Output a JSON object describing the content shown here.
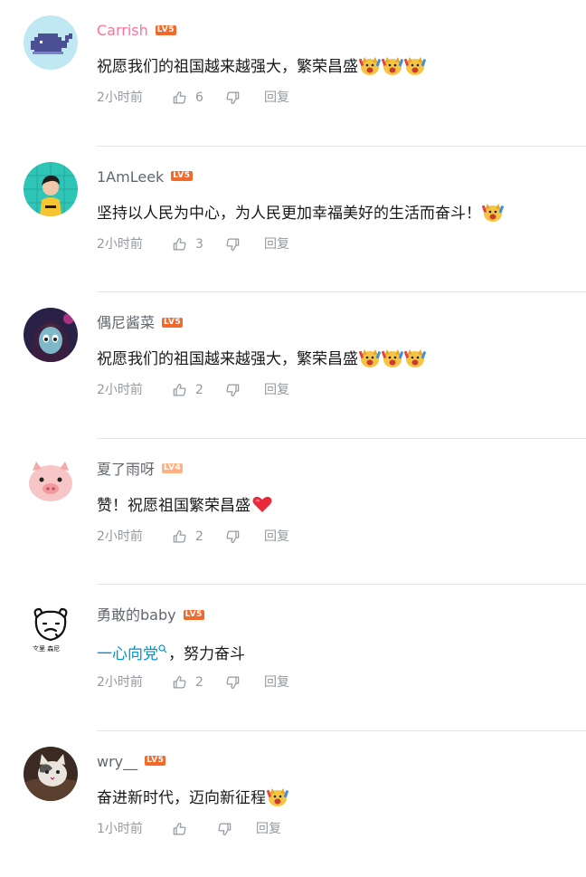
{
  "colors": {
    "username_default": "#61666d",
    "username_vip": "#fb7299",
    "link": "#0093d0",
    "meta": "#9499a0",
    "lv5": "#f26a2b",
    "lv4": "#ffb27f"
  },
  "comments": [
    {
      "username": "Carrish",
      "vip": true,
      "level": "LV5",
      "avatar_icon": "whale-icon",
      "text": "祝愿我们的祖国越来越强大，繁荣昌盛",
      "emotes": [
        "doge-cheer-emote",
        "doge-cheer-emote",
        "doge-cheer-emote"
      ],
      "time": "2小时前",
      "likes": "6",
      "reply_label": "回复"
    },
    {
      "username": "1AmLeek",
      "vip": false,
      "level": "LV5",
      "avatar_icon": "boy-in-yellow-icon",
      "text": "坚持以人民为中心，为人民更加幸福美好的生活而奋斗！",
      "emotes": [
        "doge-cheer-emote"
      ],
      "time": "2小时前",
      "likes": "3",
      "reply_label": "回复"
    },
    {
      "username": "偶尼酱菜",
      "vip": false,
      "level": "LV5",
      "avatar_icon": "anime-girl-icon",
      "text": "祝愿我们的祖国越来越强大，繁荣昌盛",
      "emotes": [
        "doge-cheer-emote",
        "doge-cheer-emote",
        "doge-cheer-emote"
      ],
      "time": "2小时前",
      "likes": "2",
      "reply_label": "回复"
    },
    {
      "username": "夏了雨呀",
      "vip": false,
      "level": "LV4",
      "avatar_icon": "pig-face-icon",
      "text": "赞！祝愿祖国繁荣昌盛",
      "emotes": [
        "red-heart-emote"
      ],
      "time": "2小时前",
      "likes": "2",
      "reply_label": "回复"
    },
    {
      "username": "勇敢的baby",
      "vip": false,
      "level": "LV5",
      "avatar_icon": "bear-doodle-icon",
      "link_text": "一心向党",
      "text": "，努力奋斗",
      "emotes": [],
      "time": "2小时前",
      "likes": "2",
      "reply_label": "回复"
    },
    {
      "username": "wry__",
      "vip": false,
      "level": "LV5",
      "avatar_icon": "cat-icon",
      "text": "奋进新时代，迈向新征程",
      "emotes": [
        "doge-cheer-emote"
      ],
      "time": "1小时前",
      "likes": "",
      "reply_label": "回复"
    }
  ]
}
